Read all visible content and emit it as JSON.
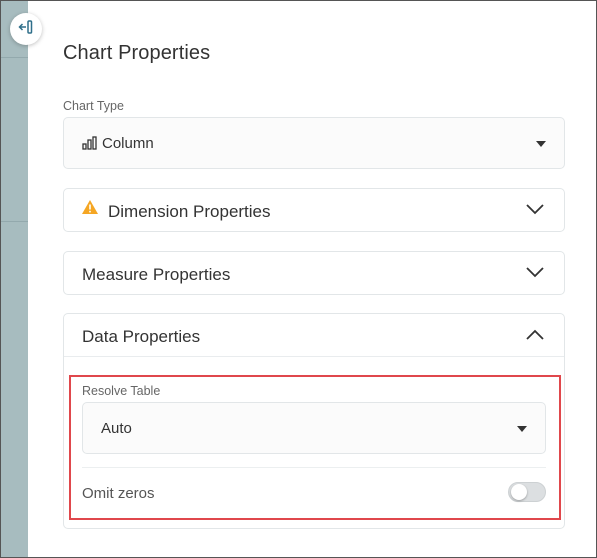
{
  "panel": {
    "title": "Chart Properties"
  },
  "chart_type": {
    "label": "Chart Type",
    "value": "Column",
    "icon": "column-chart-icon"
  },
  "sections": {
    "dimension": {
      "title": "Dimension Properties",
      "warning_icon": "warning-icon",
      "expanded": false
    },
    "measure": {
      "title": "Measure Properties",
      "expanded": false
    },
    "data": {
      "title": "Data Properties",
      "expanded": true
    }
  },
  "data_properties": {
    "resolve_table_label": "Resolve Table",
    "resolve_table_value": "Auto",
    "omit_zeros_label": "Omit zeros",
    "omit_zeros_enabled": false
  },
  "colors": {
    "sidebar": "#a7bcbf",
    "highlight": "#e0474c",
    "warning": "#f5a623"
  }
}
